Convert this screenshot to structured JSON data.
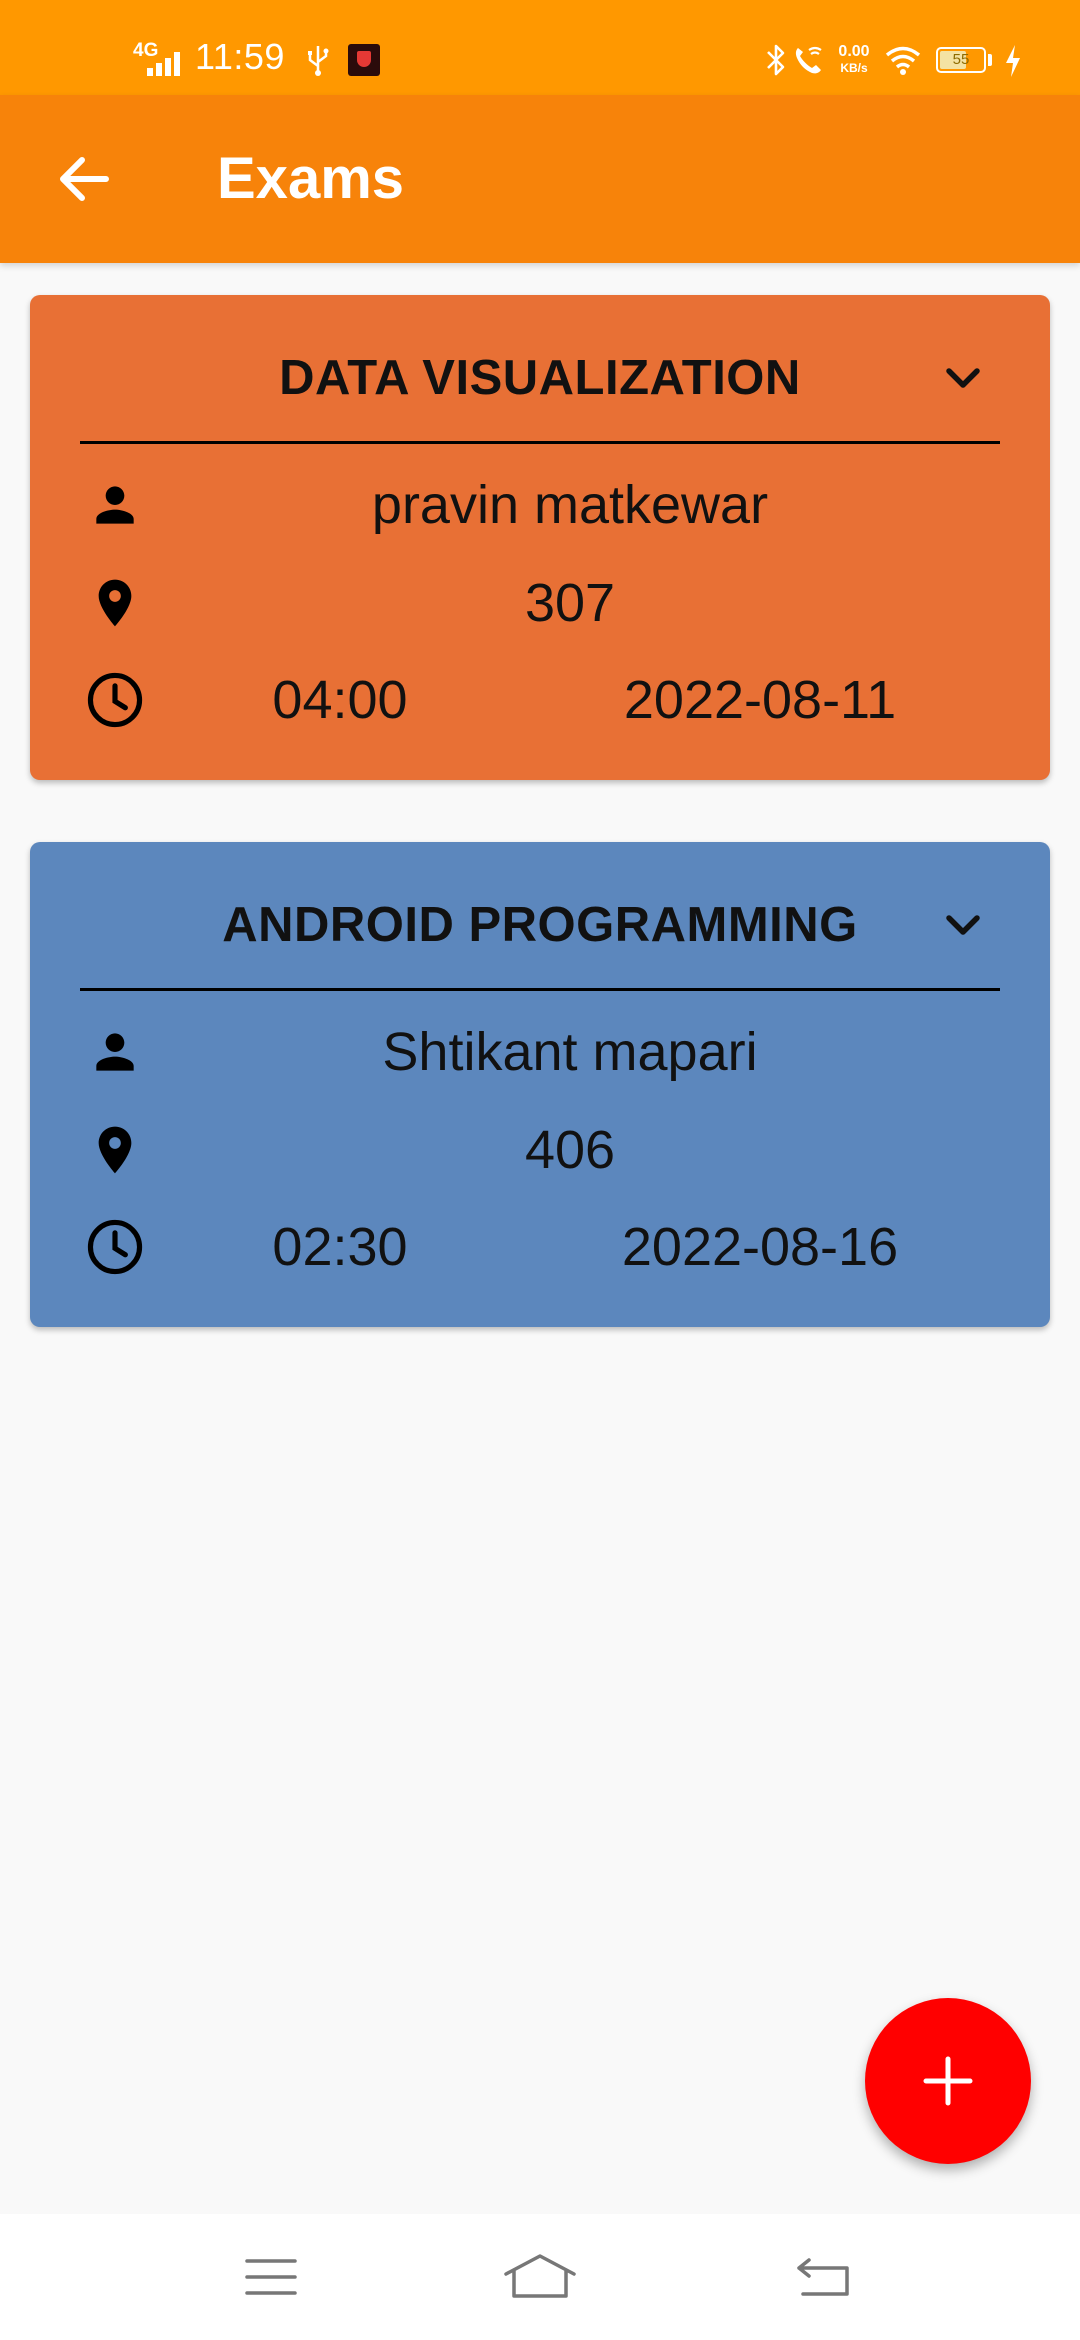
{
  "status_bar": {
    "network_type": "4G",
    "time": "11:59",
    "net_speed_value": "0.00",
    "net_speed_unit": "KB/s",
    "battery_level": "55",
    "icons": [
      "signal-icon",
      "usb-icon",
      "app-notification-icon",
      "bluetooth-icon",
      "wifi-call-icon",
      "wifi-icon",
      "battery-icon",
      "charging-icon"
    ]
  },
  "app_bar": {
    "title": "Exams",
    "back_icon": "arrow-left-icon",
    "background": "#f7830a"
  },
  "exams": [
    {
      "subject": "DATA VISUALIZATION",
      "teacher": "pravin matkewar",
      "room": "307",
      "time": "04:00",
      "date": "2022-08-11",
      "color": "#e87035"
    },
    {
      "subject": "ANDROID PROGRAMMING",
      "teacher": "Shtikant mapari",
      "room": "406",
      "time": "02:30",
      "date": "2022-08-16",
      "color": "#5c87bd"
    }
  ],
  "fab": {
    "icon": "plus-icon",
    "color": "#ff0000"
  },
  "nav_bar": {
    "icons": [
      "menu-icon",
      "home-icon",
      "back-icon"
    ]
  }
}
